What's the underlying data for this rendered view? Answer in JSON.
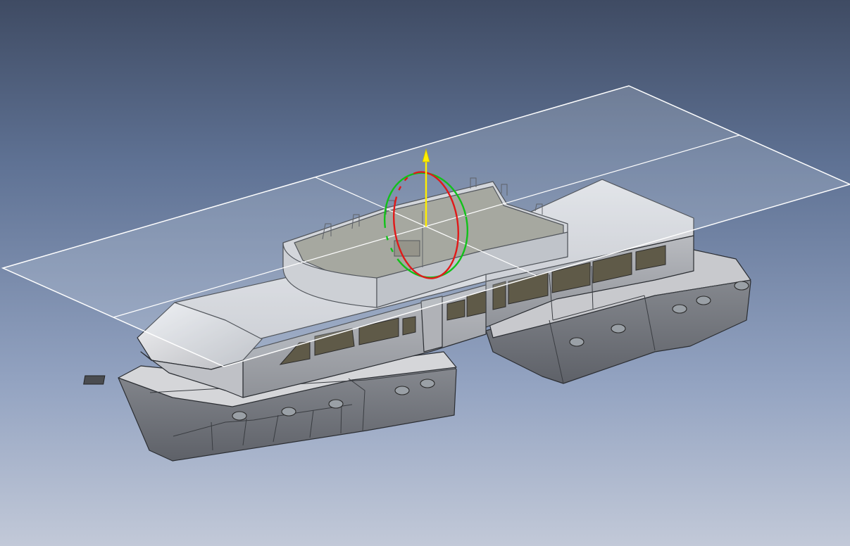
{
  "viewport": {
    "name": "3D CAD viewport",
    "colors": {
      "background_top": "#3f4b63",
      "background_bottom": "#c2c9d8",
      "body_light": "#dcdde0",
      "body_mid": "#a9abb0",
      "body_dark": "#6e7177",
      "plane_outline": "#ffffff",
      "manipulator_x": "#e11919",
      "manipulator_y": "#11c21a",
      "manipulator_z": "#ffee00"
    },
    "model": "catamaran-yacht",
    "icons": [
      "compass-manipulator-icon",
      "reference-plane-icon"
    ]
  }
}
